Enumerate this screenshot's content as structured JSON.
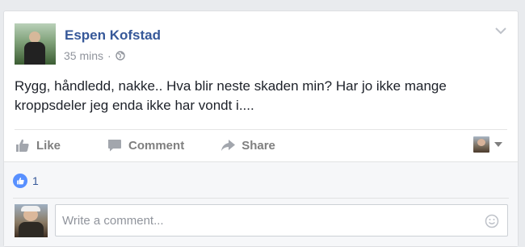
{
  "post": {
    "author": "Espen Kofstad",
    "time": "35 mins",
    "separator": "·",
    "privacy_icon": "globe-icon",
    "text": "Rygg, håndledd, nakke.. Hva blir neste skaden min? Har jo ikke mange kroppsdeler jeg enda ikke har vondt i...."
  },
  "actions": {
    "like_label": "Like",
    "comment_label": "Comment",
    "share_label": "Share"
  },
  "reactions": {
    "like_count": "1"
  },
  "comment_box": {
    "placeholder": "Write a comment..."
  },
  "colors": {
    "link_blue": "#365899",
    "action_gray": "#7f7f7f",
    "like_badge": "#5890ff",
    "background": "#e9ebee"
  }
}
